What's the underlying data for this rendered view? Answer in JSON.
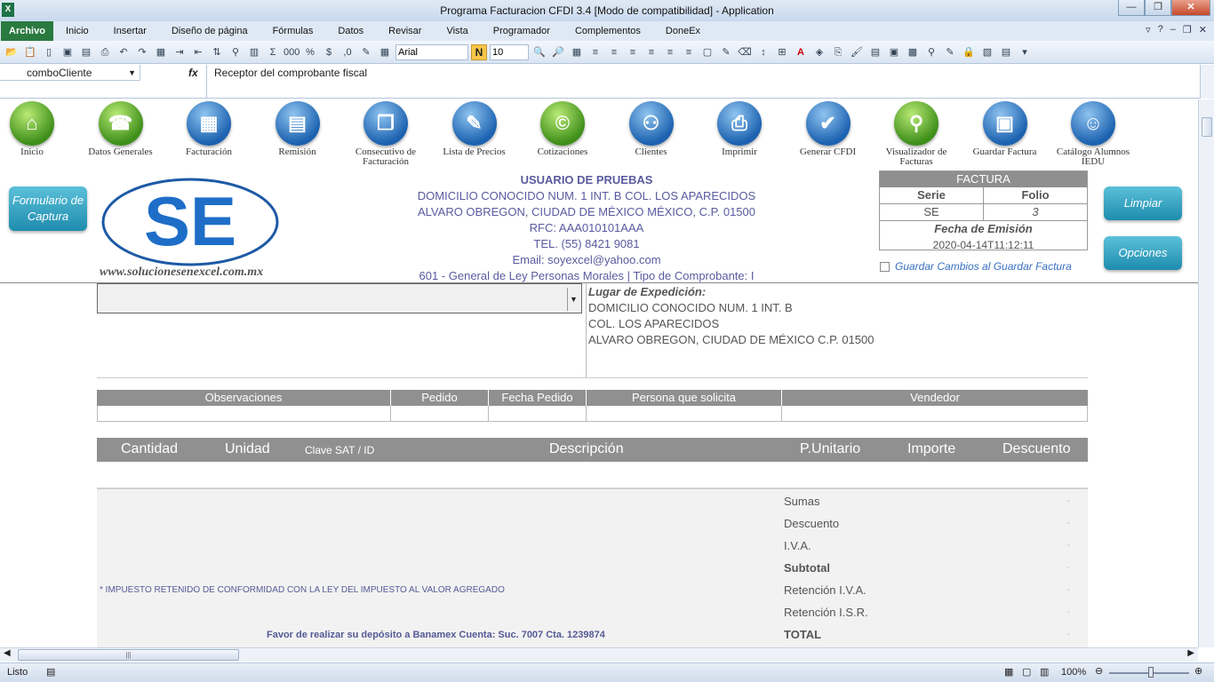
{
  "window": {
    "title": "Programa Facturacion CFDI 3.4  [Modo de compatibilidad]  -  Application"
  },
  "ribbon": {
    "tabs": [
      "Archivo",
      "Inicio",
      "Insertar",
      "Diseño de página",
      "Fórmulas",
      "Datos",
      "Revisar",
      "Vista",
      "Programador",
      "Complementos",
      "DoneEx"
    ]
  },
  "toolbar": {
    "font": "Arial",
    "size": "10",
    "bold": "N"
  },
  "formula": {
    "namebox": "comboCliente",
    "fx": "fx",
    "content": "Receptor del comprobante fiscal"
  },
  "nav": [
    {
      "label": "Inicio",
      "color": "green",
      "icon": "home-icon"
    },
    {
      "label": "Datos Generales",
      "color": "green",
      "icon": "phone-icon"
    },
    {
      "label": "Facturación",
      "color": "blue",
      "icon": "calculator-icon"
    },
    {
      "label": "Remisión",
      "color": "blue",
      "icon": "document-icon"
    },
    {
      "label": "Consecutivo de Facturación",
      "color": "blue",
      "icon": "documents-icon"
    },
    {
      "label": "Lista de Precios",
      "color": "blue",
      "icon": "price-list-icon"
    },
    {
      "label": "Cotizaciones",
      "color": "green",
      "icon": "copyright-icon"
    },
    {
      "label": "Clientes",
      "color": "blue",
      "icon": "people-icon"
    },
    {
      "label": "Imprimir",
      "color": "blue",
      "icon": "printer-icon"
    },
    {
      "label": "Generar CFDI",
      "color": "blue",
      "icon": "checkmark-icon"
    },
    {
      "label": "Visualizador de Facturas",
      "color": "green",
      "icon": "magnifier-icon"
    },
    {
      "label": "Guardar Factura",
      "color": "blue",
      "icon": "save-icon"
    },
    {
      "label": "Catálogo Alumnos IEDU",
      "color": "blue",
      "icon": "smiley-icon"
    }
  ],
  "buttons": {
    "formulario": "Formulario de Captura",
    "limpiar": "Limpiar",
    "opciones": "Opciones"
  },
  "logo": {
    "text": "SE",
    "website": "www.solucionesenexcel.com.mx"
  },
  "emisor": {
    "name": "USUARIO DE PRUEBAS",
    "line1": "DOMICILIO CONOCIDO NUM. 1 INT. B COL. LOS APARECIDOS",
    "line2": "ALVARO OBREGON, CIUDAD DE MÉXICO MÉXICO, C.P. 01500",
    "rfc": "RFC: AAA010101AAA",
    "tel": "TEL. (55) 8421 9081",
    "email": "Email: soyexcel@yahoo.com",
    "regimen": "601 - General de Ley Personas Morales | Tipo de Comprobante: I"
  },
  "factura": {
    "header": "FACTURA",
    "serie_label": "Serie",
    "folio_label": "Folio",
    "serie": "SE",
    "folio": "3",
    "fecha_label": "Fecha de Emisión",
    "fecha": "2020-04-14T11:12:11"
  },
  "guardar_cambios": "Guardar Cambios al Guardar Factura",
  "lugar": {
    "title": "Lugar de Expedición:",
    "line1": "DOMICILIO CONOCIDO NUM. 1 INT. B",
    "line2": "COL. LOS APARECIDOS",
    "line3": "ALVARO OBREGON, CIUDAD DE MÉXICO C.P. 01500"
  },
  "observaciones": {
    "headers": [
      "Observaciones",
      "Pedido",
      "Fecha Pedido",
      "Persona que solicita",
      "Vendedor"
    ]
  },
  "items": {
    "headers": [
      "Cantidad",
      "Unidad",
      "Clave SAT / ID",
      "Descripción",
      "P.Unitario",
      "Importe",
      "Descuento"
    ]
  },
  "totals": {
    "labels": [
      "Sumas",
      "Descuento",
      "I.V.A.",
      "Subtotal",
      "Retención I.V.A.",
      "Retención I.S.R.",
      "TOTAL"
    ],
    "values": [
      "-",
      "-",
      "-",
      "-",
      "-",
      "-",
      "-"
    ],
    "impuesto": "* IMPUESTO RETENIDO DE CONFORMIDAD CON LA LEY DEL IMPUESTO AL VALOR AGREGADO",
    "deposito": "Favor de realizar su depósito a Banamex Cuenta: Suc. 7007 Cta. 1239874"
  },
  "status": {
    "ready": "Listo",
    "zoom": "100%"
  }
}
